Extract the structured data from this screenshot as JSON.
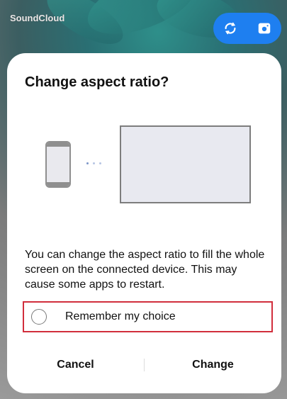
{
  "background_app": {
    "title": "SoundCloud"
  },
  "floating_controls": {
    "rotate_icon": "screen-rotate-icon",
    "capture_icon": "camera-icon",
    "accent_color": "#1e7ff0"
  },
  "dialog": {
    "title": "Change aspect ratio?",
    "description": "You can change the aspect ratio to fill the whole screen on the connected device. This may cause some apps to restart.",
    "remember_label": "Remember my choice",
    "remember_checked": false,
    "cancel_label": "Cancel",
    "change_label": "Change"
  },
  "colors": {
    "highlight_border": "#d12e3c",
    "dialog_bg": "#ffffff"
  }
}
